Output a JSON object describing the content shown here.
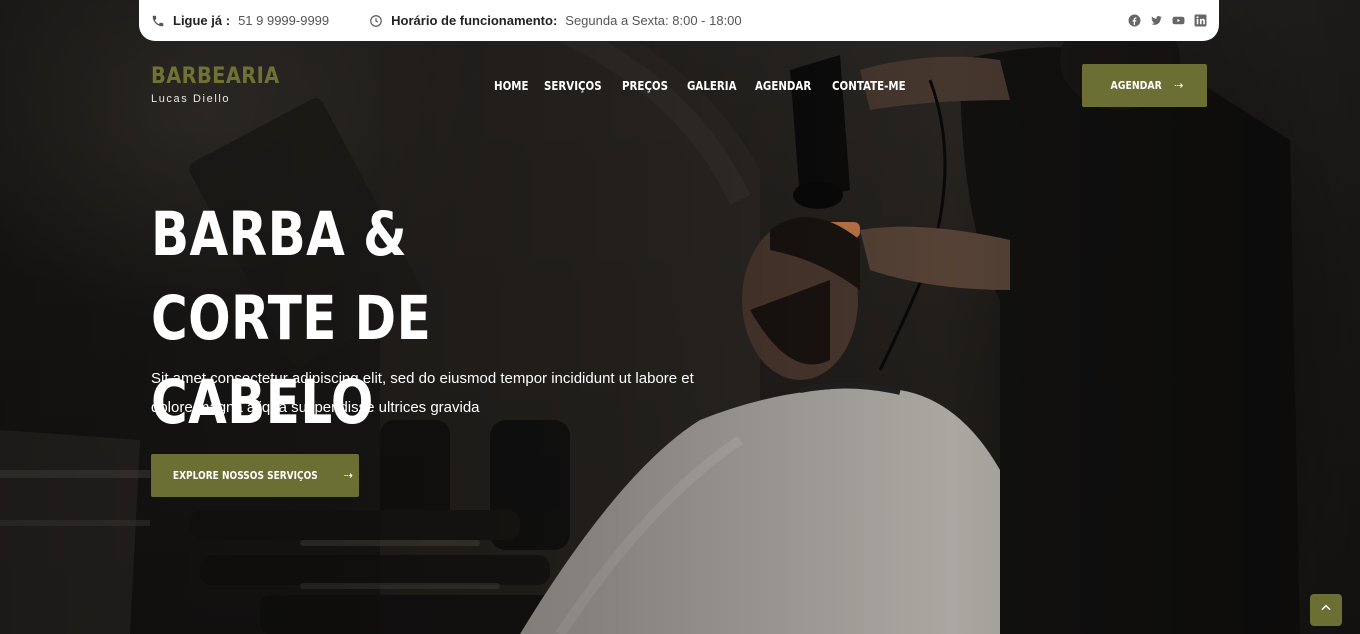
{
  "topbar": {
    "phone_label": "Ligue já :",
    "phone_value": "51 9 9999-9999",
    "hours_label": "Horário de funcionamento:",
    "hours_value": "Segunda a Sexta: 8:00 - 18:00",
    "social": [
      "facebook-icon",
      "twitter-icon",
      "youtube-icon",
      "linkedin-icon"
    ]
  },
  "header": {
    "brand": "BARBEARIA",
    "brand_sub": "Lucas Diello",
    "nav": [
      "HOME",
      "SERVIÇOS",
      "PREÇOS",
      "GALERIA",
      "AGENDAR",
      "CONTATE-ME"
    ],
    "cta": "AGENDAR"
  },
  "hero": {
    "title_line1": "BARBA & CORTE DE",
    "title_line2": "CABELO",
    "text": "Sit amet consectetur adipiscing elit, sed do eiusmod tempor incididunt ut labore et dolore magna aliqua suspendisse ultrices gravida",
    "cta": "EXPLORE NOSSOS SERVIÇOS"
  },
  "colors": {
    "accent": "#6b6f34",
    "brand_text": "#6e7334"
  }
}
